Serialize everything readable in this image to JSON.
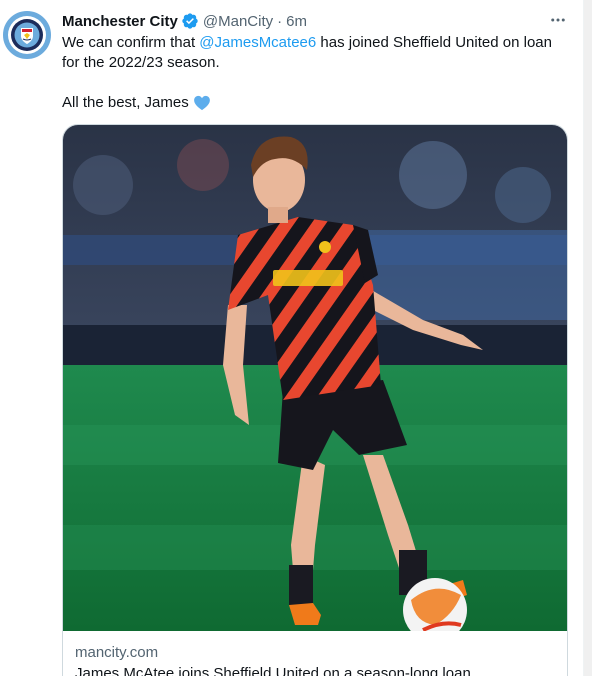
{
  "tweet": {
    "author_name": "Manchester City",
    "handle": "@ManCity",
    "separator": "·",
    "time": "6m",
    "text_before": "We can confirm that ",
    "mention": "@JamesMcatee6",
    "text_after": " has joined Sheffield United on loan",
    "text_line2": "for the 2022/23 season.",
    "closing": "All the best, James",
    "icons": {
      "verified": "verified-badge-icon",
      "more": "more-options-icon",
      "heart": "blue-heart-emoji"
    }
  },
  "card": {
    "domain": "mancity.com",
    "title": "James McAtee joins Sheffield United on a season-long loan"
  },
  "colors": {
    "accent": "#1d9bf0",
    "text": "#0f1419",
    "secondary": "#536471",
    "city_blue": "#6cabdd"
  }
}
